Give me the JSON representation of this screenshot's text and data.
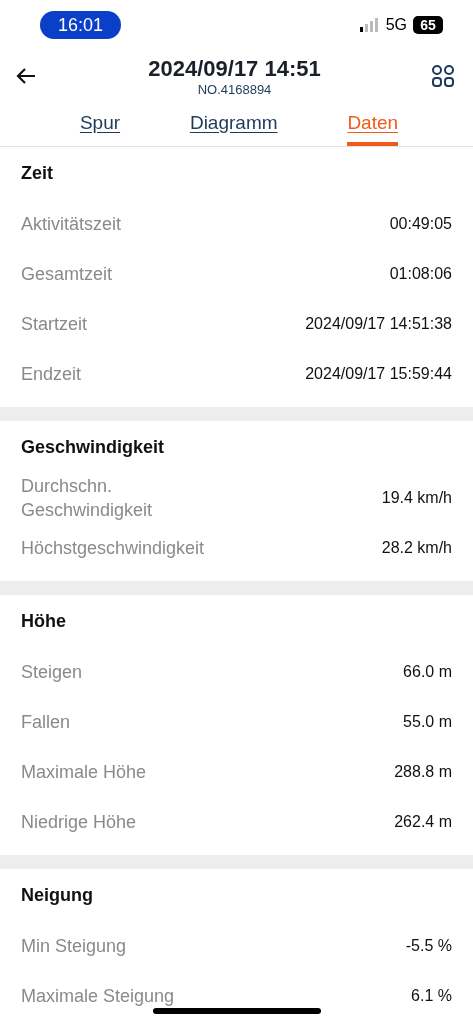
{
  "status_bar": {
    "time": "16:01",
    "network": "5G",
    "battery": "65"
  },
  "header": {
    "title": "2024/09/17 14:51",
    "subtitle": "NO.4168894"
  },
  "tabs": [
    {
      "label": "Spur",
      "selected": false
    },
    {
      "label": "Diagramm",
      "selected": false
    },
    {
      "label": "Daten",
      "selected": true
    }
  ],
  "sections": [
    {
      "title": "Zeit",
      "rows": [
        {
          "label": "Aktivitätszeit",
          "value": "00:49:05"
        },
        {
          "label": "Gesamtzeit",
          "value": "01:08:06"
        },
        {
          "label": "Startzeit",
          "value": "2024/09/17 14:51:38"
        },
        {
          "label": "Endzeit",
          "value": "2024/09/17 15:59:44"
        }
      ]
    },
    {
      "title": "Geschwindigkeit",
      "rows": [
        {
          "label": "Durchschn.\nGeschwindigkeit",
          "value": "19.4 km/h"
        },
        {
          "label": "Höchstgeschwindigkeit",
          "value": "28.2 km/h"
        }
      ]
    },
    {
      "title": "Höhe",
      "rows": [
        {
          "label": "Steigen",
          "value": "66.0 m"
        },
        {
          "label": "Fallen",
          "value": "55.0 m"
        },
        {
          "label": "Maximale Höhe",
          "value": "288.8 m"
        },
        {
          "label": "Niedrige Höhe",
          "value": "262.4 m"
        }
      ]
    },
    {
      "title": "Neigung",
      "rows": [
        {
          "label": "Min Steigung",
          "value": "-5.5 %"
        },
        {
          "label": "Maximale Steigung",
          "value": "6.1 %"
        }
      ]
    }
  ]
}
